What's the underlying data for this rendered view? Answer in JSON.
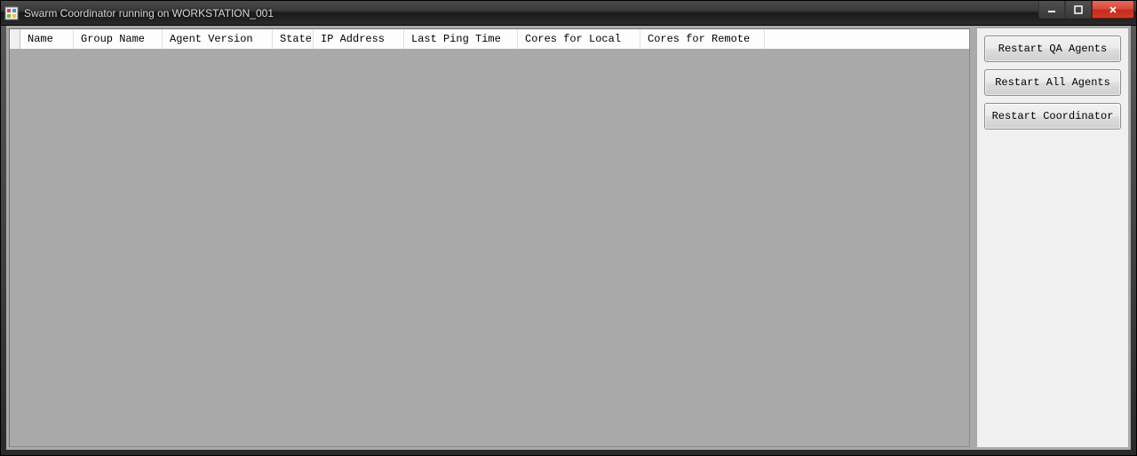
{
  "window": {
    "title": "Swarm Coordinator running on WORKSTATION_001"
  },
  "grid": {
    "columns": [
      "Name",
      "Group Name",
      "Agent Version",
      "State",
      "IP Address",
      "Last Ping Time",
      "Cores for Local",
      "Cores for Remote"
    ],
    "rows": []
  },
  "actions": {
    "restart_qa": "Restart QA Agents",
    "restart_all": "Restart All Agents",
    "restart_coordinator": "Restart Coordinator"
  }
}
